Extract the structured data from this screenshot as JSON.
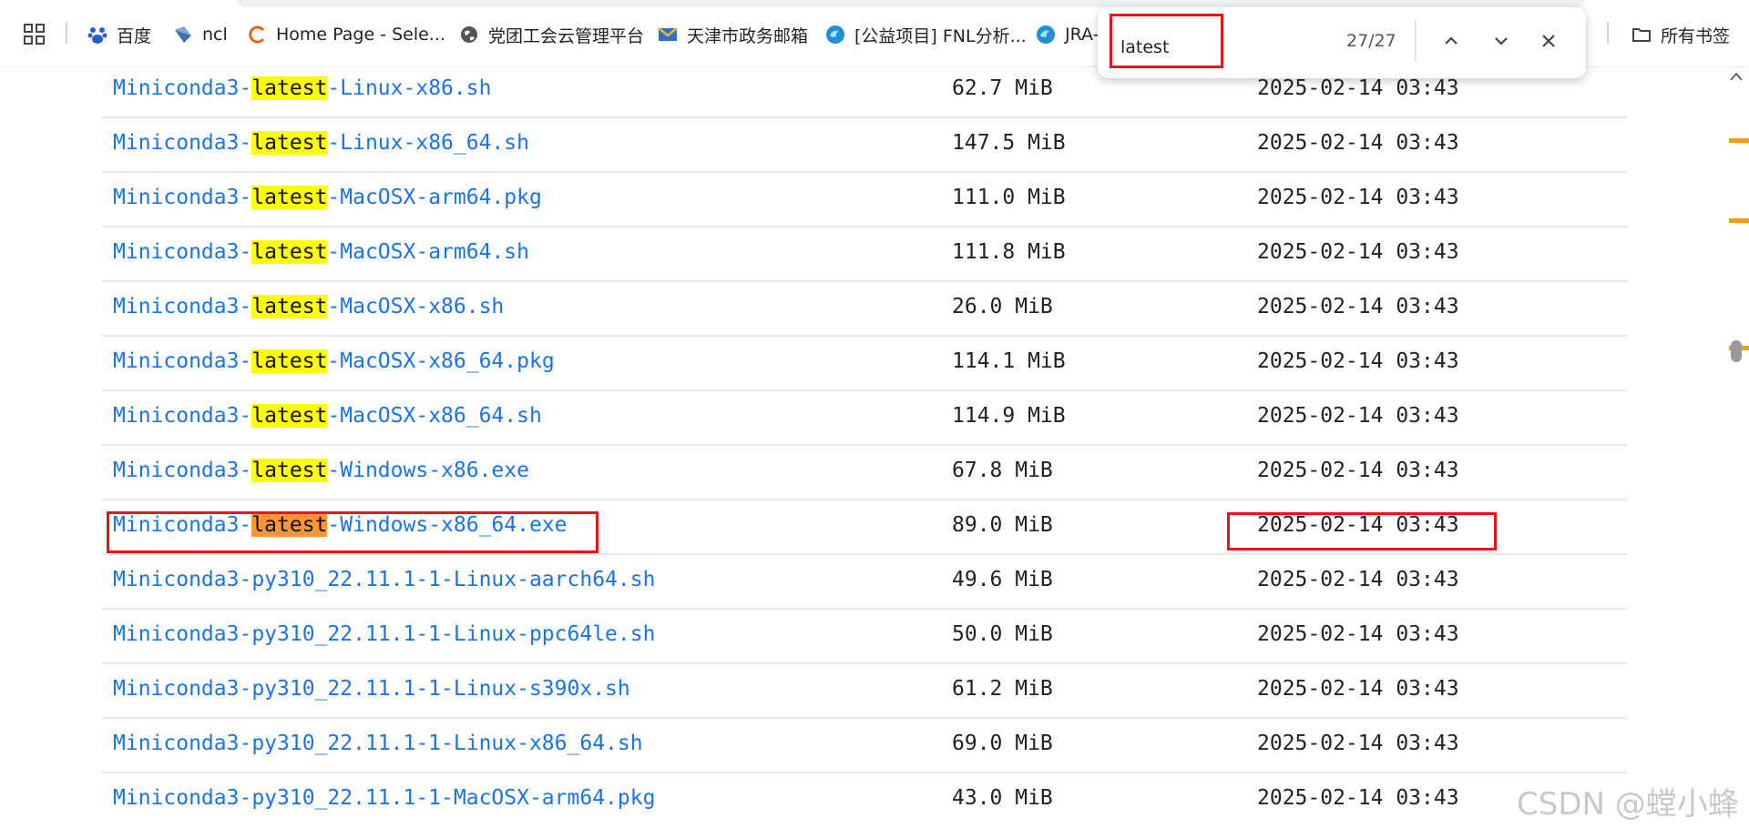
{
  "bookmarks": {
    "items": [
      {
        "label": "百度",
        "icon": "baidu-paw-icon"
      },
      {
        "label": "ncl",
        "icon": "ncl-icon"
      },
      {
        "label": "Home Page - Sele...",
        "icon": "selenium-icon"
      },
      {
        "label": "党团工会云管理平台",
        "icon": "globe-icon"
      },
      {
        "label": "天津市政务邮箱",
        "icon": "mail-icon"
      },
      {
        "label": "[公益项目] FNL分析...",
        "icon": "edge-icon"
      },
      {
        "label": "JRA-",
        "icon": "edge-icon"
      }
    ],
    "all_bookmarks_label": "所有书签"
  },
  "find_bar": {
    "query": "latest",
    "count": "27/27"
  },
  "files": [
    {
      "prefix": "Miniconda3-",
      "match": "latest",
      "suffix": "-Linux-x86.sh",
      "size": "62.7 MiB",
      "date": "2025-02-14 03:43"
    },
    {
      "prefix": "Miniconda3-",
      "match": "latest",
      "suffix": "-Linux-x86_64.sh",
      "size": "147.5 MiB",
      "date": "2025-02-14 03:43"
    },
    {
      "prefix": "Miniconda3-",
      "match": "latest",
      "suffix": "-MacOSX-arm64.pkg",
      "size": "111.0 MiB",
      "date": "2025-02-14 03:43"
    },
    {
      "prefix": "Miniconda3-",
      "match": "latest",
      "suffix": "-MacOSX-arm64.sh",
      "size": "111.8 MiB",
      "date": "2025-02-14 03:43"
    },
    {
      "prefix": "Miniconda3-",
      "match": "latest",
      "suffix": "-MacOSX-x86.sh",
      "size": "26.0 MiB",
      "date": "2025-02-14 03:43"
    },
    {
      "prefix": "Miniconda3-",
      "match": "latest",
      "suffix": "-MacOSX-x86_64.pkg",
      "size": "114.1 MiB",
      "date": "2025-02-14 03:43"
    },
    {
      "prefix": "Miniconda3-",
      "match": "latest",
      "suffix": "-MacOSX-x86_64.sh",
      "size": "114.9 MiB",
      "date": "2025-02-14 03:43"
    },
    {
      "prefix": "Miniconda3-",
      "match": "latest",
      "suffix": "-Windows-x86.exe",
      "size": "67.8 MiB",
      "date": "2025-02-14 03:43"
    },
    {
      "prefix": "Miniconda3-",
      "match": "latest",
      "suffix": "-Windows-x86_64.exe",
      "size": "89.0 MiB",
      "date": "2025-02-14 03:43",
      "active": true
    },
    {
      "prefix": "Miniconda3-py310_22.11.1-1-Linux-aarch64.sh",
      "match": "",
      "suffix": "",
      "size": "49.6 MiB",
      "date": "2025-02-14 03:43"
    },
    {
      "prefix": "Miniconda3-py310_22.11.1-1-Linux-ppc64le.sh",
      "match": "",
      "suffix": "",
      "size": "50.0 MiB",
      "date": "2025-02-14 03:43"
    },
    {
      "prefix": "Miniconda3-py310_22.11.1-1-Linux-s390x.sh",
      "match": "",
      "suffix": "",
      "size": "61.2 MiB",
      "date": "2025-02-14 03:43"
    },
    {
      "prefix": "Miniconda3-py310_22.11.1-1-Linux-x86_64.sh",
      "match": "",
      "suffix": "",
      "size": "69.0 MiB",
      "date": "2025-02-14 03:43"
    },
    {
      "prefix": "Miniconda3-py310_22.11.1-1-MacOSX-arm64.pkg",
      "match": "",
      "suffix": "",
      "size": "43.0 MiB",
      "date": "2025-02-14 03:43"
    }
  ],
  "watermark": "CSDN @螳小蜂",
  "colors": {
    "link": "#1a73e8",
    "match_highlight": "#ffff00",
    "active_match_highlight": "#ff9632",
    "annotation_red": "#e8141c"
  }
}
